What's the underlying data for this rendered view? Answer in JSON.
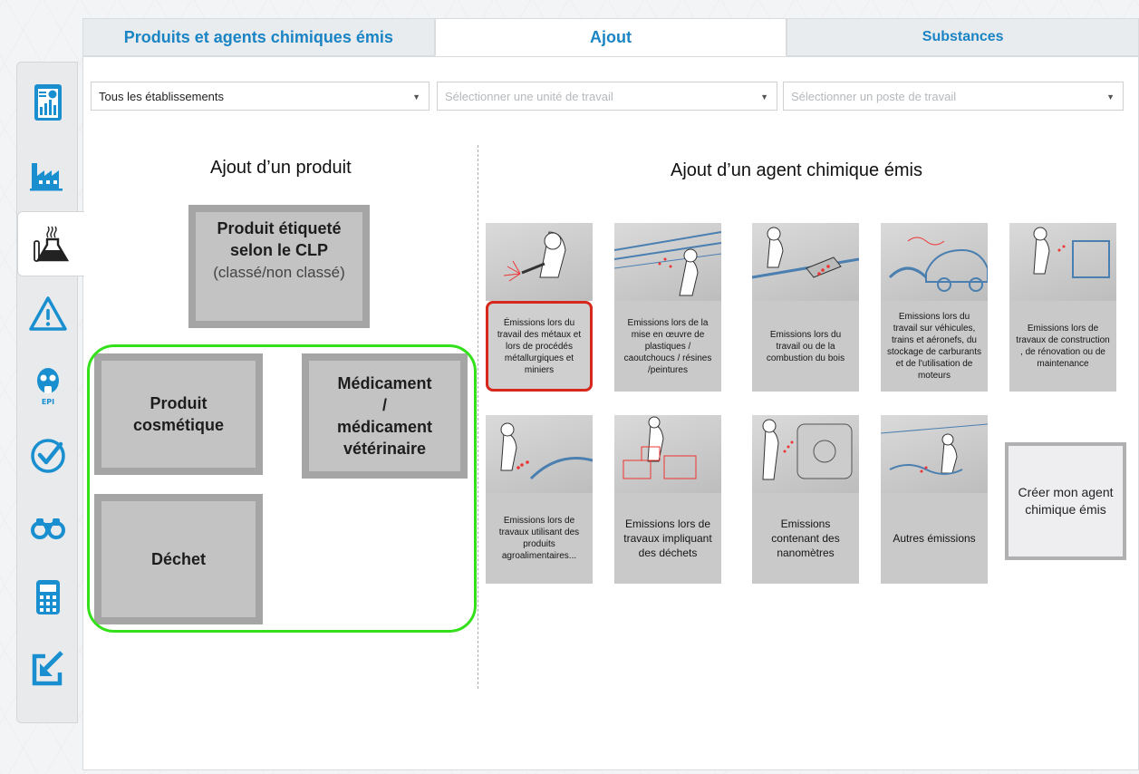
{
  "tabs": [
    {
      "label": "Produits et agents chimiques émis"
    },
    {
      "label": "Ajout"
    },
    {
      "label": "Substances"
    }
  ],
  "filters": {
    "establishment": "Tous les établissements",
    "work_unit_placeholder": "Sélectionner une unité de travail",
    "work_post_placeholder": "Sélectionner un poste de travail"
  },
  "sidebar": {
    "items": [
      {
        "icon": "dashboard-report-icon"
      },
      {
        "icon": "factory-icon"
      },
      {
        "icon": "chemical-flask-icon",
        "active": true
      },
      {
        "icon": "warning-icon"
      },
      {
        "icon": "epi-gas-mask-icon",
        "caption": "EPI"
      },
      {
        "icon": "check-icon"
      },
      {
        "icon": "binoculars-icon"
      },
      {
        "icon": "calculator-icon"
      },
      {
        "icon": "export-icon"
      }
    ]
  },
  "products": {
    "title": "Ajout d’un produit",
    "clp_main": "Produit étiqueté\nselon le CLP",
    "clp_sub": "(classé/non classé)",
    "cosmetic": "Produit\ncosmétique",
    "medicine": "Médicament\n/\nmédicament\nvétérinaire",
    "waste": "Déchet"
  },
  "agents": {
    "title": "Ajout d’un agent chimique émis",
    "cards": [
      {
        "label": "Émissions lors du travail des métaux et lors de procédés métallurgiques et miniers"
      },
      {
        "label": "Emissions lors de la mise en œuvre de plastiques / caoutchoucs / résines /peintures"
      },
      {
        "label": "Emissions lors du travail ou de la combustion du bois"
      },
      {
        "label": "Emissions lors du travail sur véhicules, trains et aéronefs, du stockage de carburants et de l'utilisation de moteurs"
      },
      {
        "label": "Emissions lors de travaux de construction , de rénovation ou de maintenance"
      },
      {
        "label": "Emissions lors de travaux utilisant des produits agroalimentaires..."
      },
      {
        "label": "Emissions lors de travaux impliquant des déchets"
      },
      {
        "label": "Emissions contenant des nanomètres"
      },
      {
        "label": "Autres émissions"
      }
    ],
    "create": "Créer mon agent chimique émis"
  }
}
